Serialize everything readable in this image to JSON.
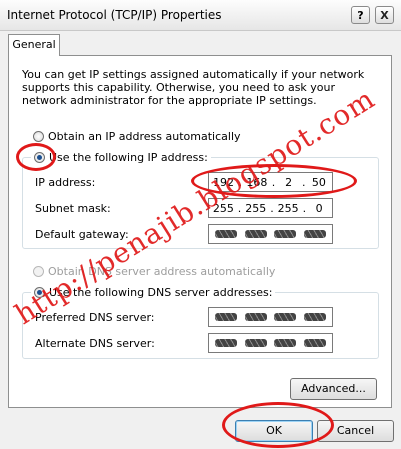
{
  "window": {
    "title": "Internet Protocol (TCP/IP) Properties",
    "help_glyph": "?",
    "close_glyph": "X"
  },
  "tabs": [
    {
      "label": "General",
      "selected": true
    }
  ],
  "description": "You can get IP settings assigned automatically if your network supports this capability. Otherwise, you need to ask your network administrator for the appropriate IP settings.",
  "ip_mode": {
    "auto_label": "Obtain an IP address automatically",
    "manual_label": "Use the following IP address:",
    "selected": "manual"
  },
  "ip_fields": {
    "ip_label": "IP address:",
    "ip_value": [
      "192",
      "168",
      "2",
      "50"
    ],
    "subnet_label": "Subnet mask:",
    "subnet_value": [
      "255",
      "255",
      "255",
      "0"
    ],
    "gateway_label": "Default gateway:"
  },
  "dns_mode": {
    "auto_label": "Obtain DNS server address automatically",
    "manual_label": "Use the following DNS server addresses:",
    "selected": "manual"
  },
  "dns_fields": {
    "preferred_label": "Preferred DNS server:",
    "alternate_label": "Alternate DNS server:"
  },
  "buttons": {
    "advanced": "Advanced...",
    "ok": "OK",
    "cancel": "Cancel"
  },
  "watermark": "http://penajib.blogspot.com",
  "annotation_color": "#e01919",
  "icons": [
    "help-icon",
    "close-icon",
    "radio-button-icon"
  ]
}
